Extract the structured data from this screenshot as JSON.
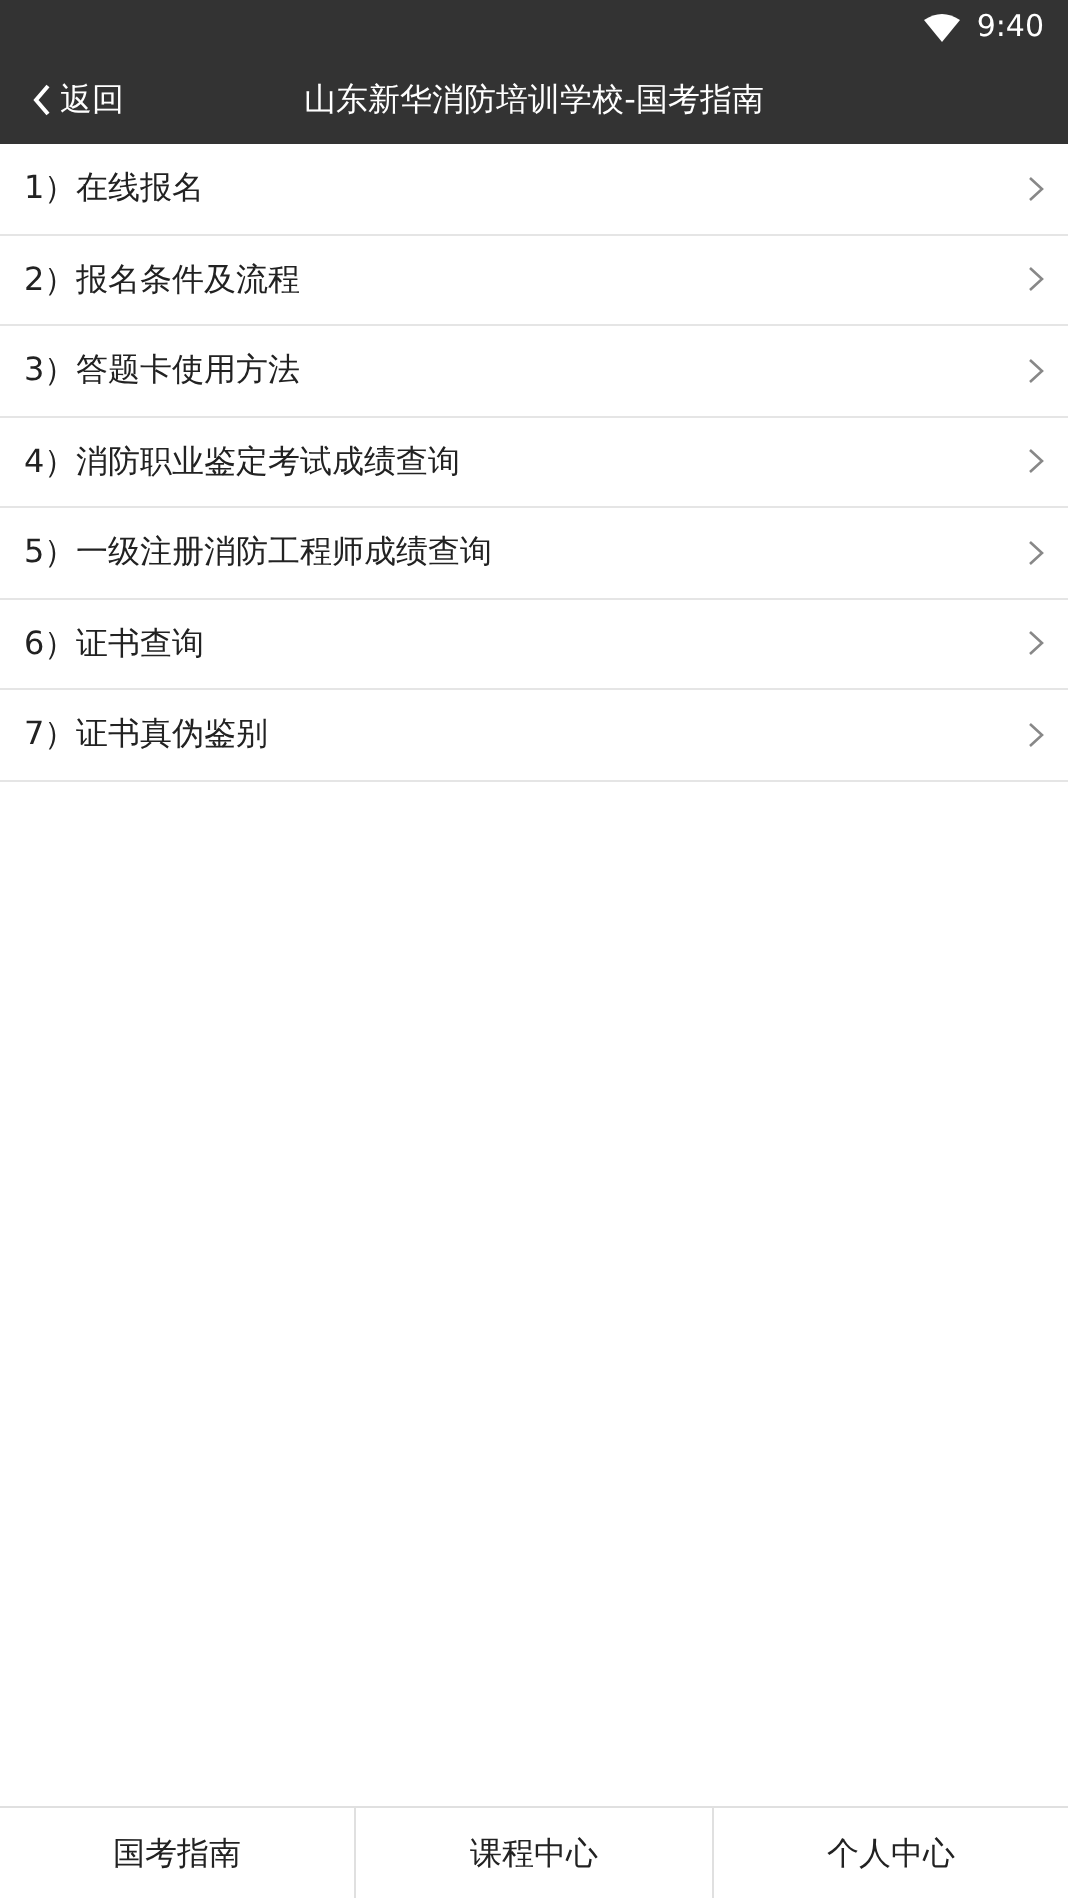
{
  "status_bar": {
    "time": "9:40"
  },
  "header": {
    "back": "返回",
    "title": "山东新华消防培训学校-国考指南"
  },
  "menu": [
    {
      "label": "1）在线报名"
    },
    {
      "label": "2）报名条件及流程"
    },
    {
      "label": "3）答题卡使用方法"
    },
    {
      "label": "4）消防职业鉴定考试成绩查询"
    },
    {
      "label": "5）一级注册消防工程师成绩查询"
    },
    {
      "label": "6）证书查询"
    },
    {
      "label": "7）证书真伪鉴别"
    }
  ],
  "tab_bar": [
    "国考指南",
    "课程中心",
    "个人中心"
  ]
}
